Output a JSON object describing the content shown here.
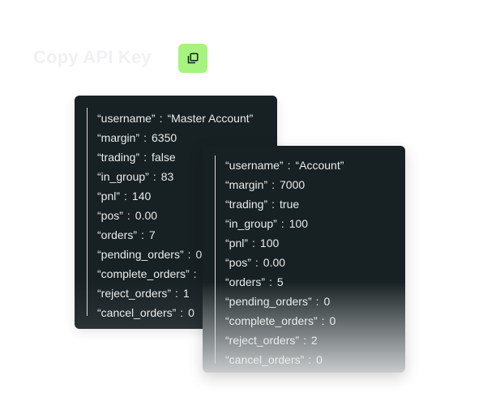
{
  "header": {
    "title": "Copy API Key",
    "copy_button": {
      "icon": "copy-icon"
    }
  },
  "colors": {
    "accent": "#a6f47f",
    "card_background": "#172022",
    "card_text": "#e9ecec"
  },
  "cards": [
    {
      "rows": [
        {
          "key": "“username”",
          "sep": ":",
          "value": "“Master Account”"
        },
        {
          "key": "“margin”",
          "sep": ":",
          "value": "6350"
        },
        {
          "key": "“trading”",
          "sep": ":",
          "value": "false"
        },
        {
          "key": "“in_group”",
          "sep": ":",
          "value": "83"
        },
        {
          "key": "“pnl”",
          "sep": ":",
          "value": "140"
        },
        {
          "key": "“pos”",
          "sep": ":",
          "value": "0.00"
        },
        {
          "key": "“orders”",
          "sep": ":",
          "value": "7"
        },
        {
          "key": "“pending_orders”",
          "sep": ":",
          "value": "0"
        },
        {
          "key": "“complete_orders”",
          "sep": ":",
          "value": ""
        },
        {
          "key": "“reject_orders”",
          "sep": ":",
          "value": "1"
        },
        {
          "key": "“cancel_orders”",
          "sep": ":",
          "value": "0"
        }
      ]
    },
    {
      "rows": [
        {
          "key": "“username”",
          "sep": ":",
          "value": "“Account”"
        },
        {
          "key": "“margin”",
          "sep": ":",
          "value": "7000"
        },
        {
          "key": "“trading”",
          "sep": ":",
          "value": "true"
        },
        {
          "key": "“in_group”",
          "sep": ":",
          "value": "100"
        },
        {
          "key": "“pnl”",
          "sep": ":",
          "value": "100"
        },
        {
          "key": "“pos”",
          "sep": ":",
          "value": "0.00"
        },
        {
          "key": "“orders”",
          "sep": ":",
          "value": "5"
        },
        {
          "key": "“pending_orders”",
          "sep": ":",
          "value": "0"
        },
        {
          "key": "“complete_orders”",
          "sep": ":",
          "value": "0"
        },
        {
          "key": "“reject_orders”",
          "sep": ":",
          "value": "2"
        },
        {
          "key": "“cancel_orders”",
          "sep": ":",
          "value": "0"
        }
      ]
    }
  ]
}
